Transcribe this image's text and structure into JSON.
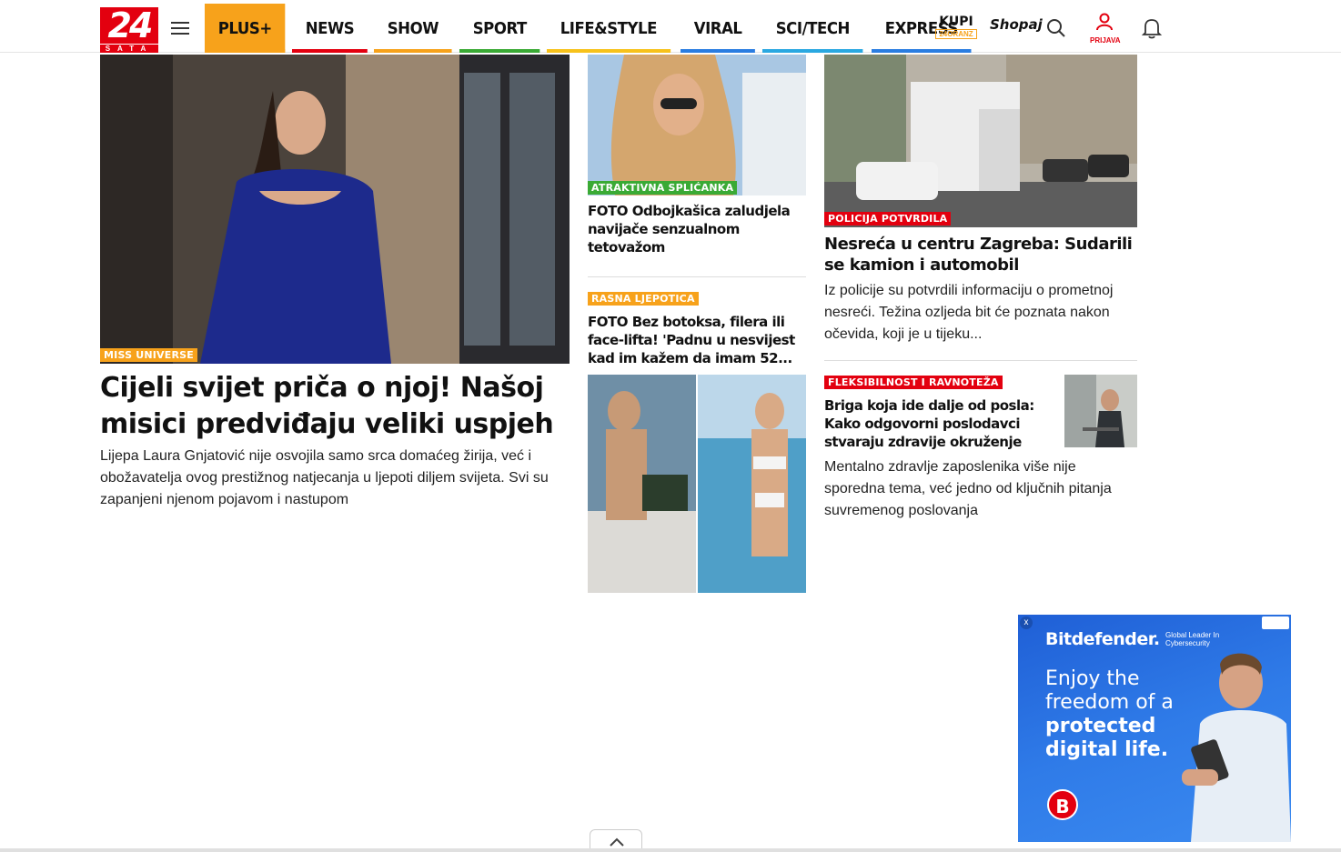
{
  "header": {
    "logo_num": "24",
    "logo_sub": "SATA",
    "nav": [
      {
        "label": "PLUS+",
        "color": "#f7a21b"
      },
      {
        "label": "NEWS",
        "color": "#e3000f"
      },
      {
        "label": "SHOW",
        "color": "#f7a21b"
      },
      {
        "label": "SPORT",
        "color": "#3aaa35"
      },
      {
        "label": "LIFE&STYLE",
        "color": "#f7c21b"
      },
      {
        "label": "VIRAL",
        "color": "#2a7de1"
      },
      {
        "label": "SCI/TECH",
        "color": "#2aa8e1"
      },
      {
        "label": "EXPRESS",
        "color": "#2a7de1"
      }
    ],
    "kupi": "KUPI",
    "kupi_sub": "24ORANZ",
    "shopaj": "Shopaj",
    "user_label": "PRIJAVA"
  },
  "main_article": {
    "tag": "MISS UNIVERSE",
    "headline": "Cijeli svijet priča o njoj! Našoj misici predviđaju veliki uspjeh",
    "lead": "Lijepa Laura Gnjatović nije osvojila samo srca domaćeg žirija, već i obožavatelja ovog prestižnog natjecanja u ljepoti diljem svijeta. Svi su zapanjeni njenom pojavom i nastupom"
  },
  "col2": [
    {
      "tag": "ATRAKTIVNA SPLIĆANKA",
      "headline": "FOTO Odbojkašica zaludjela navijače senzualnom tetovažom"
    },
    {
      "tag": "RASNA LJEPOTICA",
      "headline": "FOTO Bez botoksa, filera ili face-lifta! 'Padnu u nesvijest kad im kažem da imam 52..."
    }
  ],
  "col3": [
    {
      "tag": "POLICIJA POTVRDILA",
      "headline": "Nesreća u centru Zagreba: Sudarili se kamion i automobil",
      "lead": "Iz policije su potvrdili informaciju o prometnoj nesreći. Težina ozljeda bit će poznata nakon očevida, koji je u tijeku..."
    },
    {
      "tag": "FLEKSIBILNOST I RAVNOTEŽA",
      "headline": "Briga koja ide dalje od posla: Kako odgovorni poslodavci stvaraju zdravije okruženje",
      "lead": "Mentalno zdravlje zaposlenika više nije sporedna tema, već jedno od ključnih pitanja suvremenog poslovanja"
    }
  ],
  "ad": {
    "brand": "Bitdefender.",
    "sub": "Global Leader In Cybersecurity",
    "copy_1": "Enjoy the freedom of a ",
    "copy_bold": "protected digital life.",
    "badge": "B",
    "close": "x"
  }
}
